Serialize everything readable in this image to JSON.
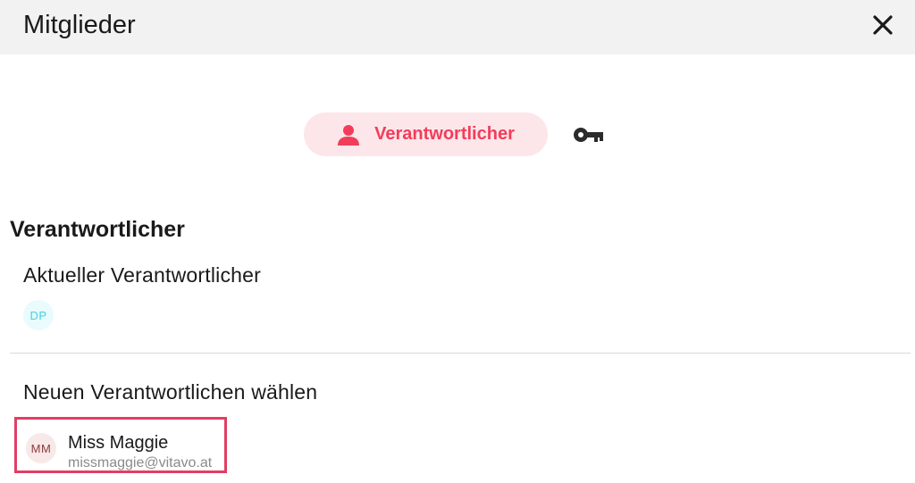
{
  "header": {
    "title": "Mitglieder",
    "close_icon": "close-icon"
  },
  "tabs": [
    {
      "label": "Verantwortlicher",
      "icon": "person-icon",
      "active": true
    },
    {
      "label": "",
      "icon": "key-icon",
      "active": false
    }
  ],
  "colors": {
    "accent": "#f23d5a",
    "accent_bg": "#fde6e9",
    "highlight_border": "#e23d63",
    "current_avatar_text": "#3fd3e0",
    "current_avatar_bg": "#e9fbfc"
  },
  "section": {
    "title": "Verantwortlicher",
    "current_label": "Aktueller Verantwortlicher",
    "current_avatar": "DP",
    "new_label": "Neuen Verantwortlichen wählen"
  },
  "members": [
    {
      "initials": "MM",
      "name": "Miss Maggie",
      "email": "missmaggie@vitavo.at"
    }
  ]
}
